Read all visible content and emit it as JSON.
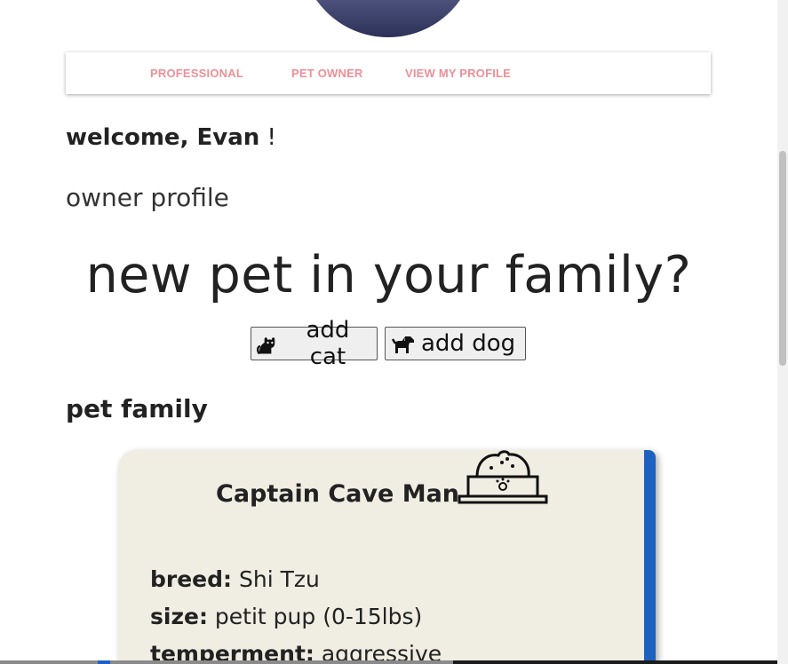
{
  "nav": {
    "items": [
      {
        "label": "PROFESSIONAL"
      },
      {
        "label": "PET OWNER"
      },
      {
        "label": "VIEW MY PROFILE"
      }
    ]
  },
  "welcome": {
    "prefix": "welcome, Evan",
    "suffix": " !"
  },
  "owner_profile": "owner profile",
  "headline": "new pet in your family?",
  "buttons": {
    "add_cat": {
      "label": "add cat",
      "icon": "cat-icon"
    },
    "add_dog": {
      "label": "add dog",
      "icon": "dog-icon"
    }
  },
  "pet_family_heading": "pet family",
  "pet_card": {
    "name": "Captain Cave Man",
    "icon": "pet-bowl-icon",
    "fields": [
      {
        "label": "breed:",
        "value": " Shi Tzu"
      },
      {
        "label": "size:",
        "value": " petit pup (0-15lbs)"
      },
      {
        "label": "temperment:",
        "value": " aggressive"
      }
    ]
  },
  "colors": {
    "nav_link": "#ee8f97",
    "card_bg": "#f0ede3",
    "card_accent": "#1d62c0"
  }
}
